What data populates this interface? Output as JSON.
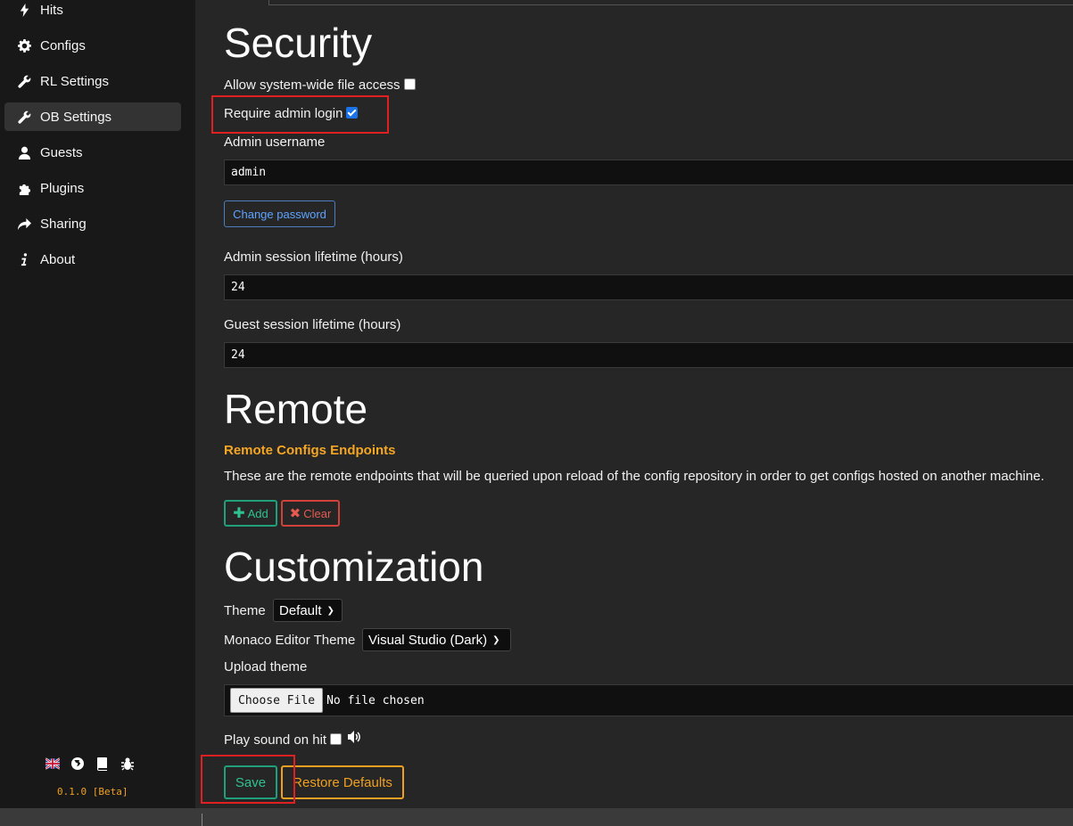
{
  "sidebar": {
    "items": [
      {
        "label": "Hits",
        "icon": "bolt-icon"
      },
      {
        "label": "Configs",
        "icon": "gear-icon"
      },
      {
        "label": "RL Settings",
        "icon": "wrench-icon"
      },
      {
        "label": "OB Settings",
        "icon": "wrench-icon",
        "active": true
      },
      {
        "label": "Guests",
        "icon": "user-icon"
      },
      {
        "label": "Plugins",
        "icon": "puzzle-icon"
      },
      {
        "label": "Sharing",
        "icon": "share-icon"
      },
      {
        "label": "About",
        "icon": "info-icon"
      }
    ],
    "footer_icons": [
      "uk-flag-icon",
      "globe-icon",
      "book-icon",
      "bug-icon"
    ],
    "version": "0.1.0 [Beta]"
  },
  "security": {
    "title": "Security",
    "system_file_access_label": "Allow system-wide file access",
    "system_file_access_checked": false,
    "require_admin_login_label": "Require admin login",
    "require_admin_login_checked": true,
    "admin_username_label": "Admin username",
    "admin_username_value": "admin",
    "change_password_label": "Change password",
    "admin_session_label": "Admin session lifetime (hours)",
    "admin_session_value": "24",
    "guest_session_label": "Guest session lifetime (hours)",
    "guest_session_value": "24"
  },
  "remote": {
    "title": "Remote",
    "subtitle": "Remote Configs Endpoints",
    "description": "These are the remote endpoints that will be queried upon reload of the config repository in order to get configs hosted on another machine.",
    "add_label": "Add",
    "clear_label": "Clear"
  },
  "customization": {
    "title": "Customization",
    "theme_label": "Theme",
    "theme_value": "Default",
    "monaco_label": "Monaco Editor Theme",
    "monaco_value": "Visual Studio (Dark)",
    "upload_label": "Upload theme",
    "choose_file_label": "Choose File",
    "no_file_label": "No file chosen",
    "play_sound_label": "Play sound on hit",
    "play_sound_checked": false
  },
  "actions": {
    "save_label": "Save",
    "restore_label": "Restore Defaults"
  },
  "colors": {
    "accent_orange": "#f0a020",
    "green": "#1fa07a",
    "red": "#d0413a",
    "blue": "#4a7ec0",
    "highlight_red": "#e02020"
  }
}
